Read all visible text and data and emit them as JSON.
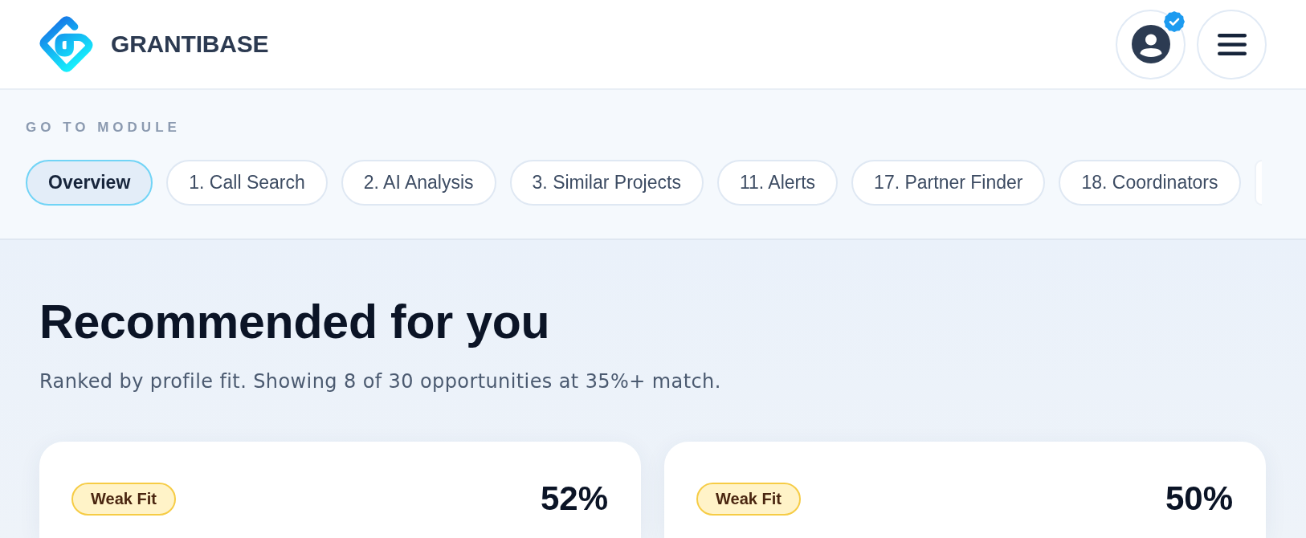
{
  "header": {
    "brand": "GRANTIBASE",
    "account": {
      "verified": true
    }
  },
  "module_nav": {
    "label": "GO TO MODULE",
    "modules": [
      {
        "kind": "pill",
        "label": "Overview",
        "selected": true
      },
      {
        "kind": "pill",
        "label": "1. Call Search",
        "selected": false
      },
      {
        "kind": "pill",
        "label": "2. AI Analysis",
        "selected": false
      },
      {
        "kind": "pill",
        "label": "3. Similar Projects",
        "selected": false
      },
      {
        "kind": "pill",
        "label": "11. Alerts",
        "selected": false
      },
      {
        "kind": "pill",
        "label": "17. Partner Finder",
        "selected": false
      },
      {
        "kind": "pill",
        "label": "18. Coordinators",
        "selected": false
      },
      {
        "kind": "cut",
        "selected": false
      }
    ]
  },
  "recommendations": {
    "title": "Recommended for you",
    "subtitle": "Ranked by profile fit. Showing 8 of 30 opportunities at 35%+ match.",
    "cards": [
      {
        "fit": "Weak Fit",
        "match": "52%"
      },
      {
        "fit": "Weak Fit",
        "match": "50%"
      }
    ]
  }
}
